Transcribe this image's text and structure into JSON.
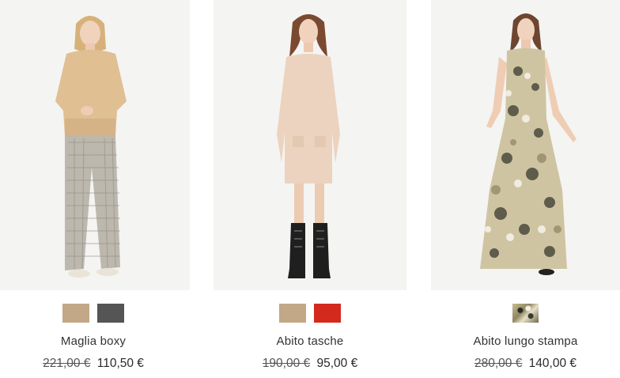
{
  "products": [
    {
      "name": "Maglia boxy",
      "old_price": "221,00 €",
      "price": "110,50 €",
      "swatches": [
        {
          "color": "#c2a886",
          "label": "beige"
        },
        {
          "color": "#555555",
          "label": "grigio scuro"
        }
      ]
    },
    {
      "name": "Abito tasche",
      "old_price": "190,00 €",
      "price": "95,00 €",
      "swatches": [
        {
          "color": "#c2a886",
          "label": "beige"
        },
        {
          "color": "#d42a1e",
          "label": "rosso"
        }
      ]
    },
    {
      "name": "Abito lungo stampa",
      "old_price": "280,00 €",
      "price": "140,00 €",
      "swatches": [
        {
          "color": "pattern",
          "label": "stampa paisley"
        }
      ]
    }
  ]
}
